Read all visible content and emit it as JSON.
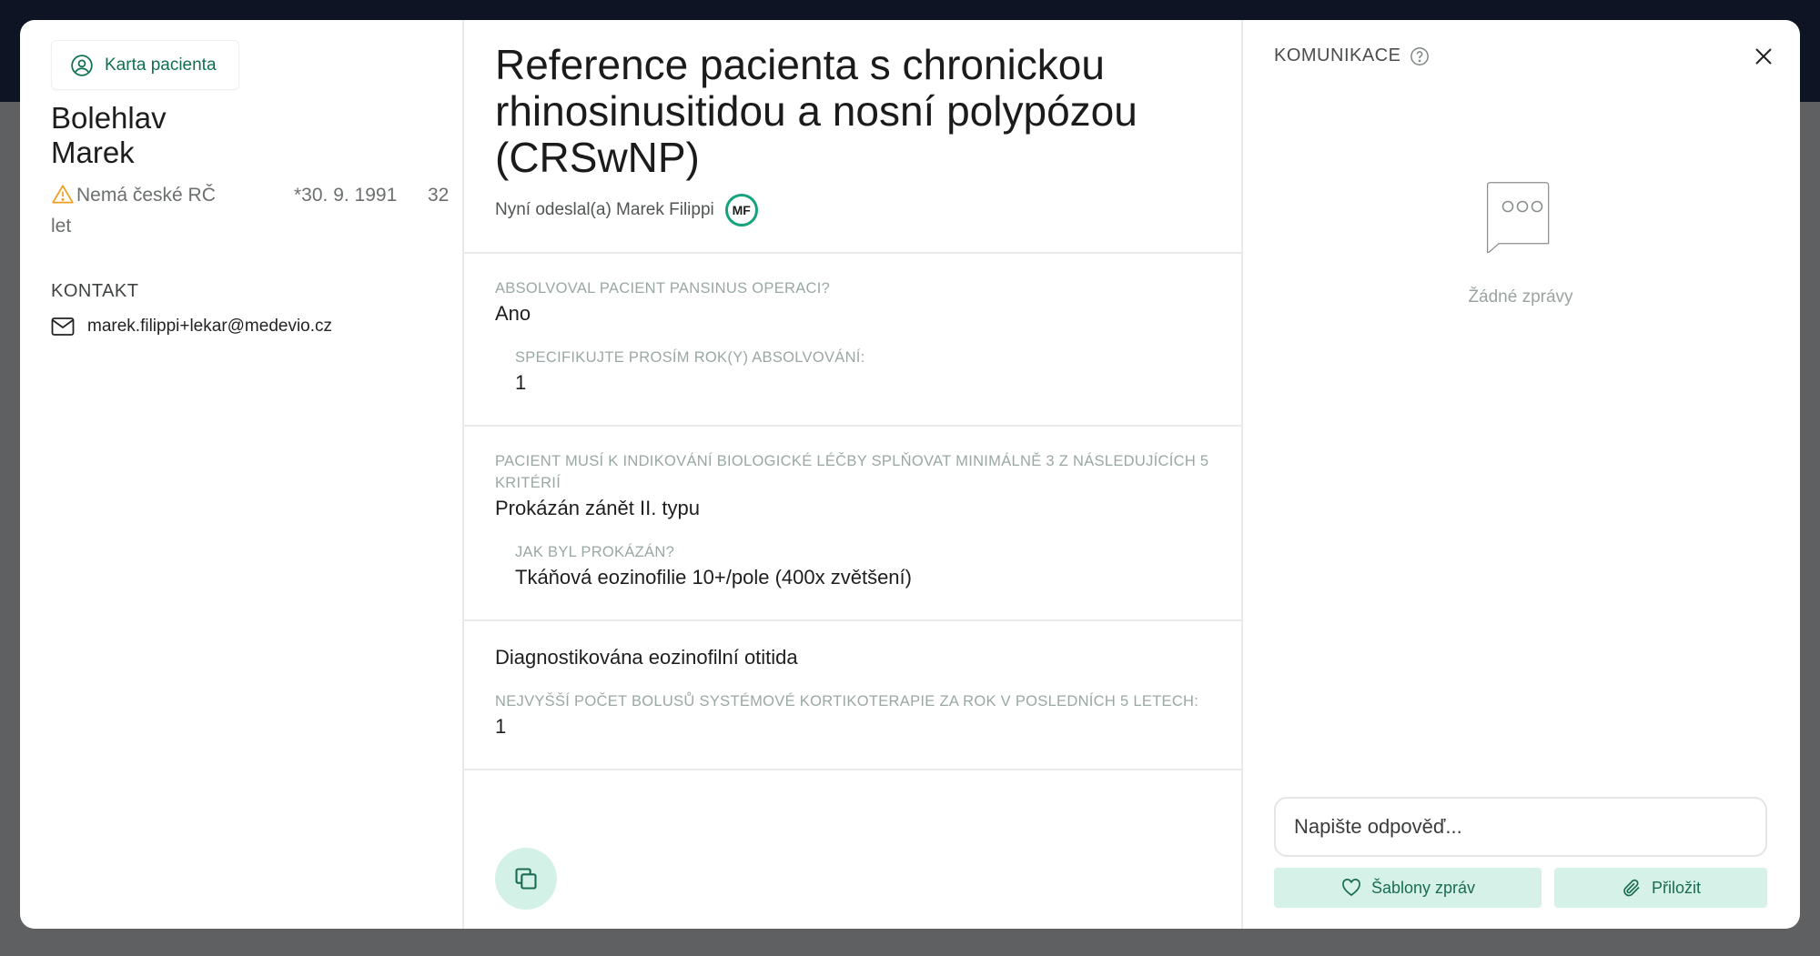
{
  "patient": {
    "card_button": "Karta pacienta",
    "surname": "Bolehlav",
    "firstname": "Marek",
    "no_rc": "Nemá české RČ",
    "birth": "*30. 9. 1991",
    "age_num": "32",
    "age_unit": "let",
    "contact_label": "KONTAKT",
    "email": "marek.filippi+lekar@medevio.cz"
  },
  "referral": {
    "title": "Reference pacienta s chronickou rhinosinusitidou a nosní polypózou (CRSwNP)",
    "sender": "Nyní odeslal(a) Marek Filippi",
    "sender_initials": "MF",
    "blocks": [
      {
        "question": "ABSOLVOVAL PACIENT PANSINUS OPERACI?",
        "answer": "Ano",
        "sub_question": "SPECIFIKUJTE PROSÍM ROK(Y) ABSOLVOVÁNÍ:",
        "sub_answer": "1"
      },
      {
        "question": "PACIENT MUSÍ K INDIKOVÁNÍ BIOLOGICKÉ LÉČBY SPLŇOVAT MINIMÁLNĚ 3 Z NÁSLEDUJÍCÍCH 5 KRITÉRIÍ",
        "answer": "Prokázán zánět II. typu",
        "sub_question": "JAK BYL PROKÁZÁN?",
        "sub_answer": "Tkáňová eozinofilie 10+/pole (400x zvětšení)"
      },
      {
        "answer": "Diagnostikována eozinofilní otitida",
        "question": "NEJVYŠŠÍ POČET BOLUSŮ SYSTÉMOVÉ KORTIKOTERAPIE ZA ROK V POSLEDNÍCH 5 LETECH:",
        "answer2": "1"
      }
    ]
  },
  "communication": {
    "title": "KOMUNIKACE",
    "empty_text": "Žádné zprávy",
    "reply_placeholder": "Napište odpověď...",
    "templates_button": "Šablony zpráv",
    "attach_button": "Přiložit"
  },
  "colors": {
    "accent": "#14a37c",
    "button_bg": "#d6f2e8",
    "warning": "#f0a020",
    "topbar": "#0f1424"
  },
  "icons": [
    "user-circle-icon",
    "warning-icon",
    "mail-icon",
    "copy-icon",
    "help-icon",
    "close-icon",
    "chat-bubble-icon",
    "heart-icon",
    "paperclip-icon"
  ]
}
